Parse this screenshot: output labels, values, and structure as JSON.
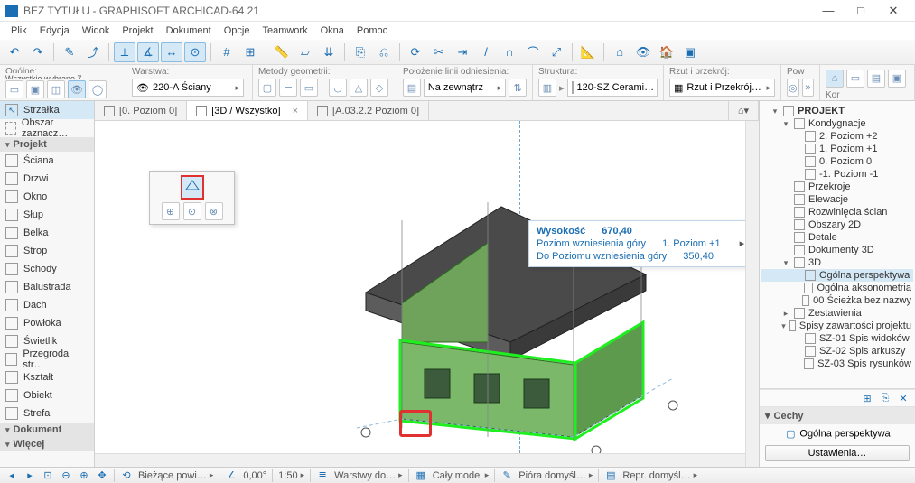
{
  "window": {
    "title": "BEZ TYTUŁU - GRAPHISOFT ARCHICAD-64 21"
  },
  "menu": [
    "Plik",
    "Edycja",
    "Widok",
    "Projekt",
    "Dokument",
    "Opcje",
    "Teamwork",
    "Okna",
    "Pomoc"
  ],
  "options": {
    "general": {
      "label": "Ogólne:",
      "sub": "Wszystkie wybrane 7"
    },
    "layer": {
      "label": "Warstwa:",
      "value": "220-A Ściany"
    },
    "geom": {
      "label": "Metody geometrii:"
    },
    "refline": {
      "label": "Położenie linii odniesienia:",
      "value": "Na zewnątrz"
    },
    "struct": {
      "label": "Struktura:",
      "value": "120-SZ Cerami…"
    },
    "plan": {
      "label": "Rzut i przekrój:",
      "value": "Rzut i Przekrój…"
    },
    "pow": {
      "label": "Pow",
      "kor": "Kor"
    }
  },
  "toolbox": {
    "arrow": "Strzałka",
    "marquee": "Obszar zaznacz…",
    "sections": {
      "projekt": "Projekt",
      "dokument": "Dokument",
      "wiecej": "Więcej"
    },
    "tools": [
      "Ściana",
      "Drzwi",
      "Okno",
      "Słup",
      "Belka",
      "Strop",
      "Schody",
      "Balustrada",
      "Dach",
      "Powłoka",
      "Świetlik",
      "Przegroda str…",
      "Kształt",
      "Obiekt",
      "Strefa"
    ]
  },
  "tabs": [
    {
      "label": "[0. Poziom 0]"
    },
    {
      "label": "[3D / Wszystko]",
      "closable": true,
      "active": true
    },
    {
      "label": "[A.03.2.2 Poziom 0]"
    }
  ],
  "hint": {
    "r1k": "Wysokość",
    "r1v": "670,40",
    "r2k": "Poziom wzniesienia góry",
    "r2v": "1. Poziom  +1",
    "r3k": "Do Poziomu wzniesienia góry",
    "r3v": "350,40"
  },
  "navigator": {
    "root": "PROJEKT",
    "groups": {
      "kondygnacje": "Kondygnacje",
      "levels": [
        "2. Poziom +2",
        "1. Poziom +1",
        "0. Poziom 0",
        "-1. Poziom -1"
      ],
      "przekroje": "Przekroje",
      "elewacje": "Elewacje",
      "rozwiniecia": "Rozwinięcia ścian",
      "obszary2d": "Obszary 2D",
      "detale": "Detale",
      "dok3d": "Dokumenty 3D",
      "3d": "3D",
      "views3d": [
        "Ogólna perspektywa",
        "Ogólna aksonometria",
        "00 Ścieżka bez nazwy"
      ],
      "zestawienia": "Zestawienia",
      "spisy": "Spisy zawartości projektu",
      "spislists": [
        "SZ-01 Spis widoków",
        "SZ-02 Spis arkuszy",
        "SZ-03 Spis rysunków"
      ]
    },
    "properties": {
      "header": "Cechy",
      "viewName": "Ogólna perspektywa",
      "settings": "Ustawienia…"
    }
  },
  "statusbar": {
    "workspace": "Bieżące powi…",
    "angle": "0,00°",
    "scale": "1:50",
    "layers": "Warstwy do…",
    "model": "Cały model",
    "pens": "Pióra domyśl…",
    "repr": "Repr. domyśl…"
  }
}
